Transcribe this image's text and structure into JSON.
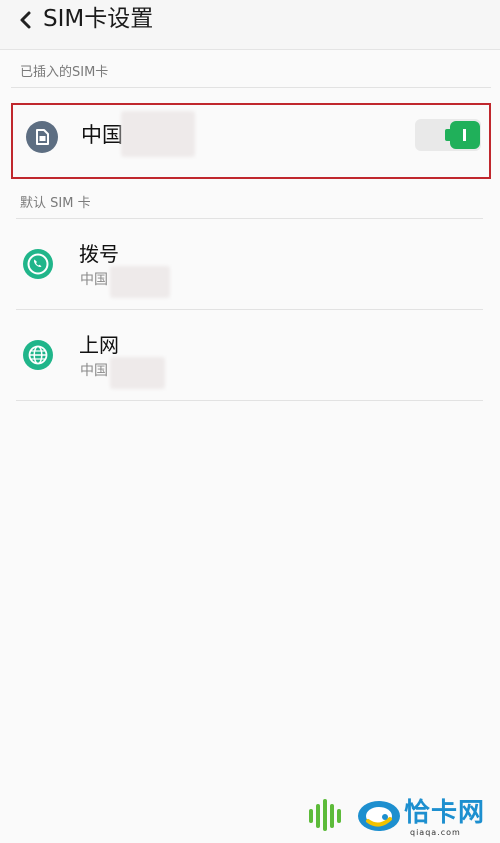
{
  "header": {
    "title": "SIM卡设置"
  },
  "inserted_section": {
    "label": "已插入的SIM卡"
  },
  "sim_card": {
    "name": "中国",
    "enabled": true
  },
  "default_section": {
    "label": "默认 SIM 卡"
  },
  "dial": {
    "title": "拨号",
    "subtitle": "中国"
  },
  "data": {
    "title": "上网",
    "subtitle": "中国"
  },
  "watermark": {
    "text": "恰卡网",
    "url": "qiaqa.com"
  },
  "colors": {
    "accent_green": "#20b05a",
    "row_icon_teal": "#20b58a",
    "highlight_red": "#c0272d",
    "sim_icon_gray": "#5d6e82",
    "watermark_blue": "#1d8fcf"
  }
}
